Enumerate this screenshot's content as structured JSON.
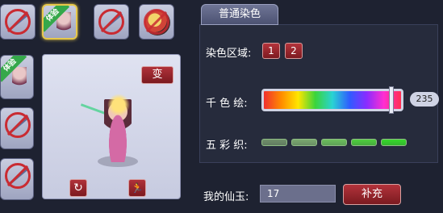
{
  "items": [
    {
      "badge": ""
    },
    {
      "badge": "体验"
    },
    {
      "badge": ""
    },
    {
      "badge": ""
    },
    {
      "badge": "体验"
    },
    {
      "badge": ""
    },
    {
      "badge": ""
    }
  ],
  "preview": {
    "transform_label": "变",
    "rotate_icon": "↻",
    "action_icon": "🏃"
  },
  "dye": {
    "tab_label": "普通染色",
    "region_label": "染色区域:",
    "regions": [
      "1",
      "2"
    ],
    "hue_label": "千 色 绘:",
    "hue_value": "235",
    "hue_fraction": 0.93,
    "saturation_label": "五 彩 织:",
    "saturation_segments": 5
  },
  "currency": {
    "label": "我的仙玉:",
    "value": "17",
    "recharge_label": "补充"
  },
  "colors": {
    "accent_red": "#b3333b",
    "selected_gold": "#e7c84a",
    "panel_bg": "#262b3c"
  }
}
